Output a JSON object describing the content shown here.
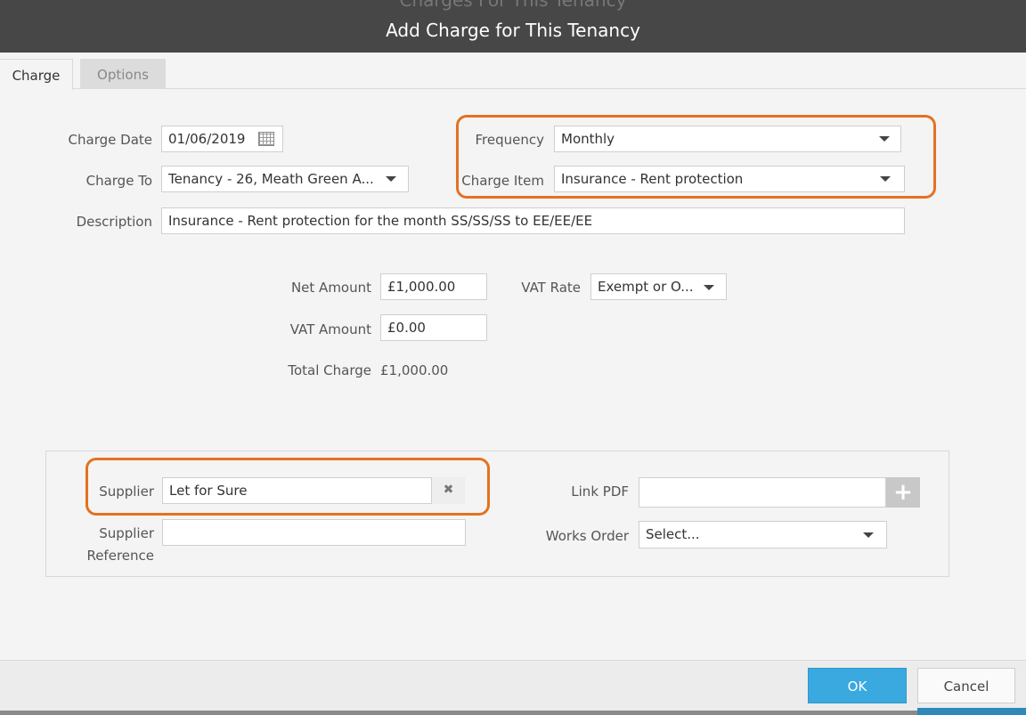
{
  "window": {
    "background_title": "Charges For This Tenancy",
    "title": "Add Charge for This Tenancy"
  },
  "tabs": [
    {
      "label": "Charge",
      "active": true
    },
    {
      "label": "Options",
      "active": false
    }
  ],
  "form": {
    "charge_date": {
      "label": "Charge Date",
      "value": "01/06/2019",
      "icon": "calendar-icon"
    },
    "charge_to": {
      "label": "Charge To",
      "value": "Tenancy - 26, Meath Green A..."
    },
    "frequency": {
      "label": "Frequency",
      "value": "Monthly"
    },
    "charge_item": {
      "label": "Charge Item",
      "value": "Insurance - Rent protection"
    },
    "description": {
      "label": "Description",
      "value": "Insurance - Rent protection for the month SS/SS/SS to EE/EE/EE"
    },
    "net_amount": {
      "label": "Net Amount",
      "value": "£1,000.00"
    },
    "vat_rate": {
      "label": "VAT Rate",
      "value": "Exempt or O..."
    },
    "vat_amount": {
      "label": "VAT Amount",
      "value": "£0.00"
    },
    "total_charge": {
      "label": "Total Charge",
      "value": "£1,000.00"
    }
  },
  "supplier_panel": {
    "supplier": {
      "label": "Supplier",
      "value": "Let for Sure",
      "clear_icon": "close-icon"
    },
    "supplier_reference": {
      "label_line1": "Supplier",
      "label_line2": "Reference",
      "value": ""
    },
    "link_pdf": {
      "label": "Link PDF",
      "value": "",
      "add_icon": "plus-icon"
    },
    "works_order": {
      "label": "Works Order",
      "value": "Select..."
    }
  },
  "footer": {
    "ok_label": "OK",
    "cancel_label": "Cancel"
  },
  "colors": {
    "titlebar": "#474747",
    "highlight": "#e37222",
    "ok_button": "#3aa9df"
  }
}
